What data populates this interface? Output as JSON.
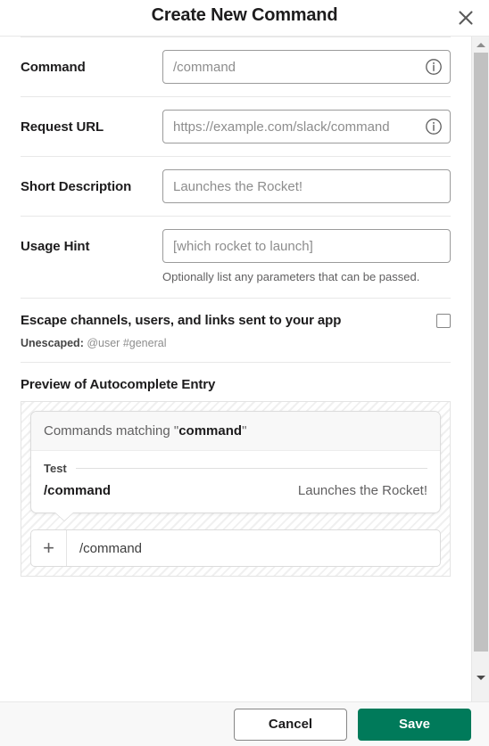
{
  "header": {
    "title": "Create New Command",
    "close_icon": "close-icon"
  },
  "form": {
    "fields": [
      {
        "label": "Command",
        "placeholder": "/command",
        "value": "",
        "has_info_icon": true,
        "info_icon": "info-circle-icon"
      },
      {
        "label": "Request URL",
        "placeholder": "https://example.com/slack/command",
        "value": "",
        "has_info_icon": true,
        "info_icon": "info-circle-icon"
      },
      {
        "label": "Short Description",
        "placeholder": "Launches the Rocket!",
        "value": "",
        "has_info_icon": false
      },
      {
        "label": "Usage Hint",
        "placeholder": "[which rocket to launch]",
        "value": "",
        "has_info_icon": false,
        "helper": "Optionally list any parameters that can be passed."
      }
    ]
  },
  "escape": {
    "label": "Escape channels, users, and links sent to your app",
    "checkbox_checked": false,
    "sub_prefix": "Unescaped:",
    "sub_value": "@user #general"
  },
  "preview": {
    "title": "Preview of Autocomplete Entry",
    "autocomplete": {
      "header_prefix": "Commands matching \"",
      "header_term": "command",
      "header_suffix": "\"",
      "section_label": "Test",
      "command": "/command",
      "description": "Launches the Rocket!"
    },
    "composer": {
      "plus_icon": "plus-icon",
      "plus_glyph": "+",
      "text": "/command"
    }
  },
  "footer": {
    "cancel_label": "Cancel",
    "save_label": "Save"
  },
  "colors": {
    "accent_green": "#007a5a",
    "text_primary": "#1d1c1d",
    "text_secondary": "#616061",
    "placeholder": "#8d8d8d",
    "border": "#9b9b9b"
  },
  "scrollbar": {
    "up_arrow_icon": "chevron-up-icon",
    "down_arrow_icon": "chevron-down-icon"
  }
}
